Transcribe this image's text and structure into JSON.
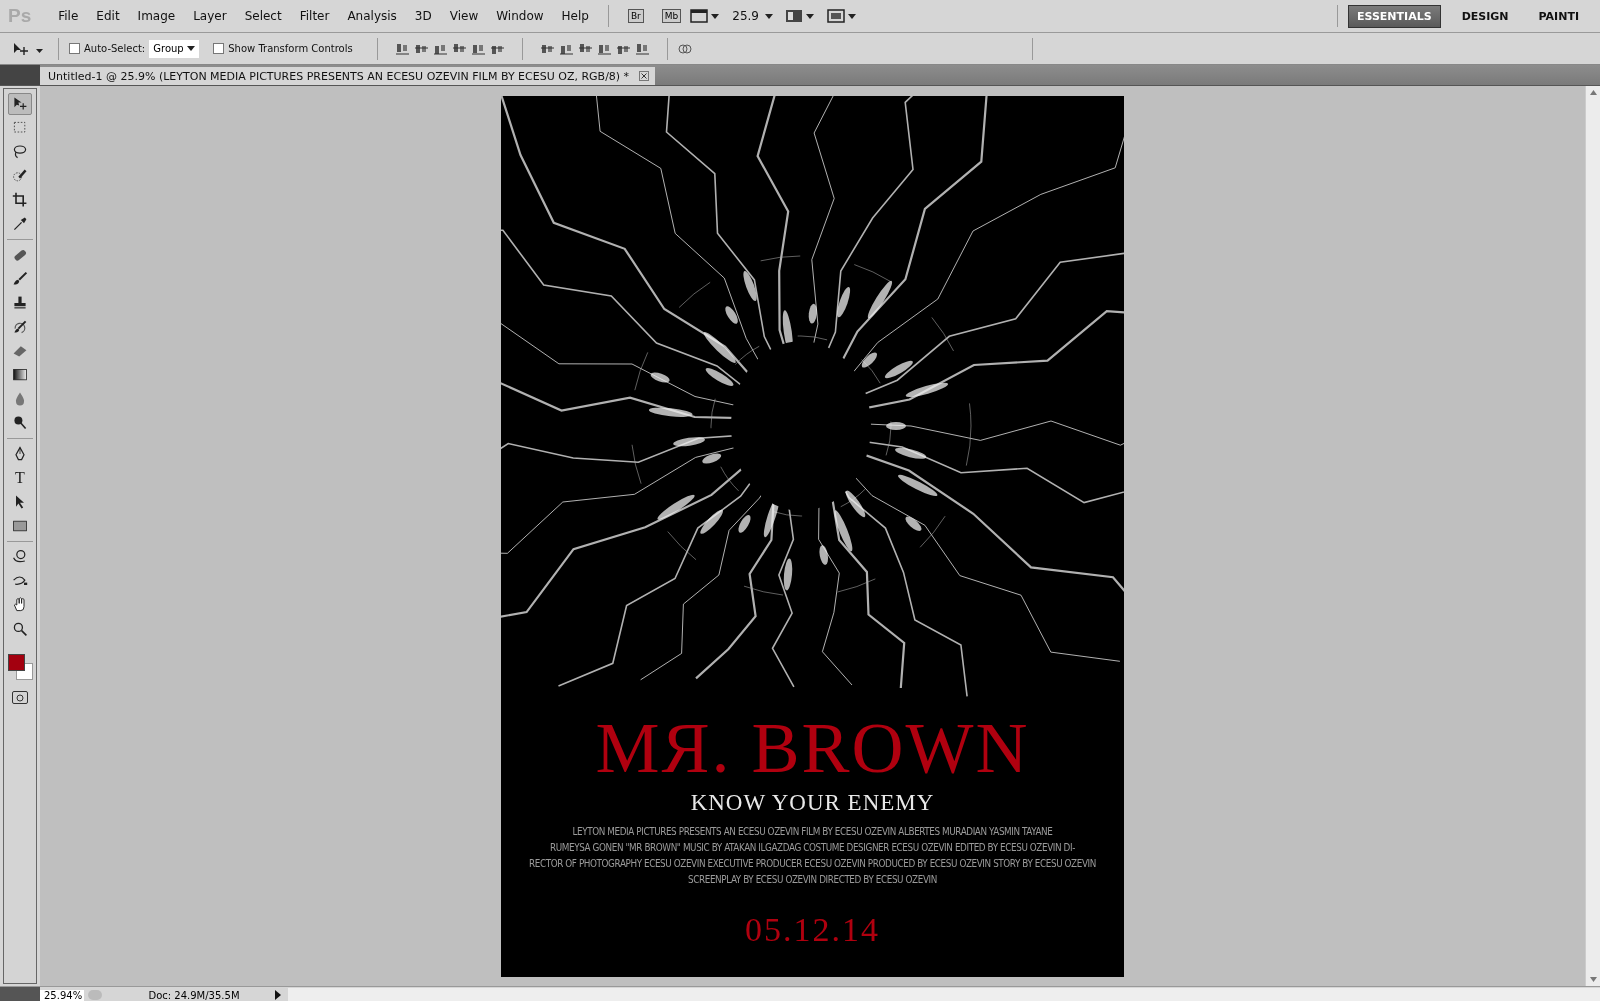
{
  "app_logo": "Ps",
  "menu": [
    "File",
    "Edit",
    "Image",
    "Layer",
    "Select",
    "Filter",
    "Analysis",
    "3D",
    "View",
    "Window",
    "Help"
  ],
  "app_bar": {
    "bridge": "Br",
    "mini_bridge": "Mb",
    "zoom": "25.9"
  },
  "workspaces": [
    {
      "label": "ESSENTIALS",
      "selected": true
    },
    {
      "label": "DESIGN",
      "selected": false
    },
    {
      "label": "PAINTI",
      "selected": false
    }
  ],
  "options_bar": {
    "auto_select": {
      "label": "Auto-Select:",
      "checked": false
    },
    "auto_select_target": "Group",
    "transform_controls": {
      "label": "Show Transform Controls",
      "checked": false
    }
  },
  "document_tab": {
    "title": "Untitled-1 @ 25.9% (LEYTON MEDIA PICTURES PRESENTS AN ECESU OZEVIN FILM BY ECESU OZ, RGB/8) *"
  },
  "tool_groups": [
    [
      {
        "kind": "move",
        "selected": true
      },
      {
        "kind": "marquee",
        "selected": false
      },
      {
        "kind": "lasso",
        "selected": false
      },
      {
        "kind": "quick-select",
        "selected": false
      },
      {
        "kind": "crop",
        "selected": false
      },
      {
        "kind": "eyedropper",
        "selected": false
      }
    ],
    [
      {
        "kind": "healing",
        "selected": false
      },
      {
        "kind": "brush",
        "selected": false
      },
      {
        "kind": "stamp",
        "selected": false
      },
      {
        "kind": "history-brush",
        "selected": false
      },
      {
        "kind": "eraser",
        "selected": false
      },
      {
        "kind": "gradient",
        "selected": false
      },
      {
        "kind": "blur",
        "selected": false
      },
      {
        "kind": "dodge",
        "selected": false
      }
    ],
    [
      {
        "kind": "pen",
        "selected": false
      },
      {
        "kind": "type",
        "glyph": "T",
        "selected": false
      },
      {
        "kind": "path-select",
        "selected": false
      },
      {
        "kind": "rectangle",
        "selected": false
      }
    ],
    [
      {
        "kind": "rotate-3d",
        "selected": false
      },
      {
        "kind": "orbit-3d",
        "selected": false
      },
      {
        "kind": "hand",
        "selected": false
      },
      {
        "kind": "zoom",
        "selected": false
      }
    ]
  ],
  "poster": {
    "title": "MЯ. BROWN",
    "tagline": "KNOW YOUR ENEMY",
    "credits": [
      "LEYTON MEDIA PICTURES PRESENTS AN ECESU OZEVIN FILM BY ECESU OZEVIN ALBERTES MURADIAN YASMIN TAYANE",
      "RUMEYSA GONEN \"MR BROWN\" MUSIC BY ATAKAN ILGAZDAG COSTUME DESIGNER ECESU OZEVIN EDITED BY ECESU OZEVIN DI-",
      "RECTOR OF PHOTOGRAPHY ECESU OZEVIN EXECUTIVE PRODUCER ECESU OZEVIN PRODUCED BY ECESU OZEVIN STORY BY ECESU OZEVIN",
      "SCREENPLAY BY ECESU OZEVIN DIRECTED BY ECESU OZEVIN"
    ],
    "date": "05.12.14"
  },
  "status_bar": {
    "zoom": "25.94%",
    "doc_size": "Doc: 24.9M/35.5M"
  }
}
